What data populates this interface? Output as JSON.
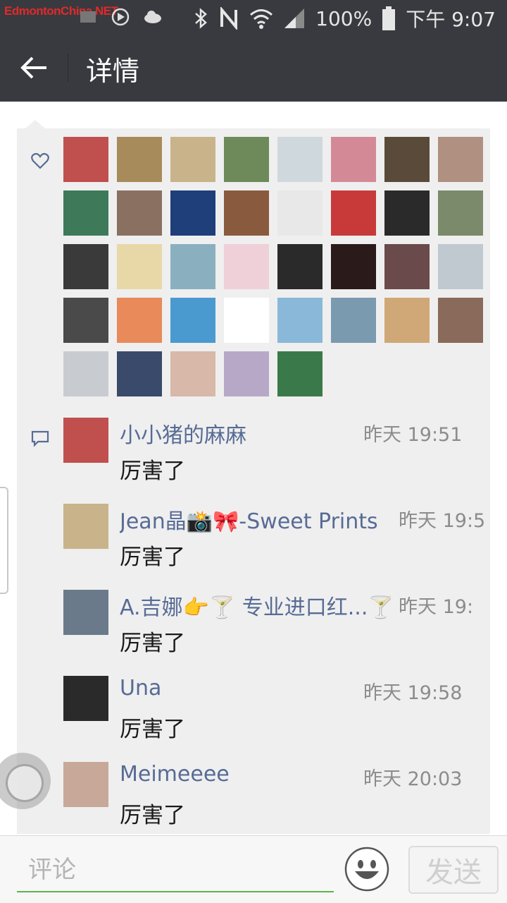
{
  "status_bar": {
    "watermark": "EdmontonChina.NET",
    "battery": "100%",
    "time": "下午 9:07"
  },
  "header": {
    "title": "详情",
    "back_icon": "arrow-left-icon"
  },
  "likes": {
    "icon": "heart-outline-icon",
    "avatar_colors": [
      [
        "#c0504d",
        "#a88b5a",
        "#c9b38a",
        "#6f8a5a",
        "#cfd8dc",
        "#d48a96",
        "#5a4a3a",
        "#b09080"
      ],
      [
        "#3e7a5a",
        "#8a7060",
        "#1e3f7a",
        "#8a5a3e",
        "#e8e8e8",
        "#c83a3a",
        "#2a2a2a",
        "#7a8a6a"
      ],
      [
        "#3a3a3a",
        "#e8d8a8",
        "#8ab0c0",
        "#f0d0d8",
        "#2a2a2a",
        "#2a1a1a",
        "#6a4a4a",
        "#c0c8d0"
      ],
      [
        "#4a4a4a",
        "#e88a5a",
        "#4a9ad0",
        "#ffffff",
        "#8ab8d8",
        "#7a9ab0",
        "#d0a878",
        "#8a6a5a"
      ],
      [
        "#c8ccd0",
        "#3a4a6a",
        "#d8b8a8",
        "#b8a8c8",
        "#3a7a4a"
      ]
    ]
  },
  "comments": {
    "icon": "comment-bubble-icon",
    "items": [
      {
        "name": "小小猪的麻麻",
        "time": "昨天 19:51",
        "text": "厉害了",
        "avatar_color": "#c0504d"
      },
      {
        "name": "Jean晶📸🎀-Sweet Prints",
        "time": "昨天 19:5",
        "text": "厉害了",
        "avatar_color": "#c9b38a"
      },
      {
        "name": "A.吉娜👉🍸 专业进口红...🍸",
        "time": "昨天 19:",
        "text": "厉害了",
        "avatar_color": "#6a7a8a"
      },
      {
        "name": "Una",
        "time": "昨天 19:58",
        "text": "厉害了",
        "avatar_color": "#2a2a2a"
      },
      {
        "name": "Meimeeee",
        "time": "昨天 20:03",
        "text": "厉害了",
        "avatar_color": "#c8a898"
      }
    ]
  },
  "input_bar": {
    "placeholder": "评论",
    "emoji_icon": "smiley-icon",
    "send_label": "发送"
  }
}
